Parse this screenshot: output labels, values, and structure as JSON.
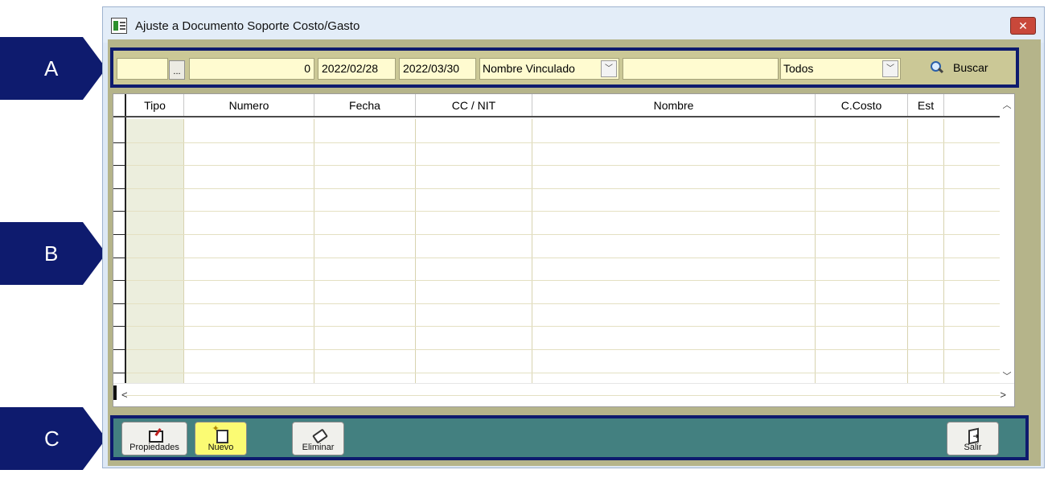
{
  "callouts": {
    "a": "A",
    "b": "B",
    "c": "C"
  },
  "window": {
    "title": "Ajuste a Documento Soporte Costo/Gasto",
    "close_glyph": "✕"
  },
  "filter": {
    "tipo_value": "",
    "dots_label": "...",
    "numero_value": "0",
    "fecha_desde": "2022/02/28",
    "fecha_hasta": "2022/03/30",
    "campo_busqueda": "Nombre Vinculado",
    "texto_busqueda": "",
    "estado": "Todos",
    "buscar_label": "Buscar"
  },
  "grid": {
    "columns": [
      {
        "label": "Tipo"
      },
      {
        "label": "Numero"
      },
      {
        "label": "Fecha"
      },
      {
        "label": "CC / NIT"
      },
      {
        "label": "Nombre"
      },
      {
        "label": "C.Costo"
      },
      {
        "label": "Est"
      },
      {
        "label": ""
      }
    ],
    "rows": []
  },
  "actions": {
    "propiedades": "Propiedades",
    "nuevo": "Nuevo",
    "eliminar": "Eliminar",
    "salir": "Salir"
  },
  "icons": [
    "app-form-icon",
    "close-icon",
    "search-icon",
    "properties-icon",
    "new-document-icon",
    "eraser-icon",
    "exit-icon"
  ],
  "colors": {
    "callout": "#0e1b6e",
    "input_bg": "#fffbd0",
    "footer_bg": "#438080",
    "close_btn": "#c9483a"
  }
}
